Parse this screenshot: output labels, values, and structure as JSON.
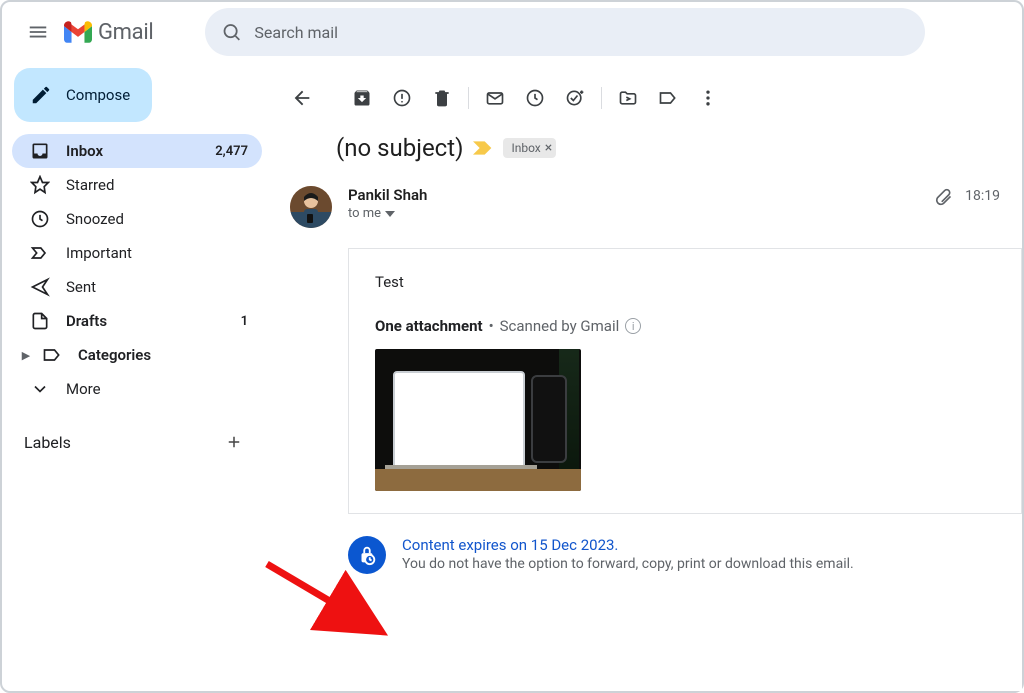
{
  "app": {
    "brand": "Gmail"
  },
  "search": {
    "placeholder": "Search mail"
  },
  "compose": {
    "label": "Compose"
  },
  "sidebar": {
    "items": [
      {
        "label": "Inbox",
        "count": "2,477"
      },
      {
        "label": "Starred",
        "count": ""
      },
      {
        "label": "Snoozed",
        "count": ""
      },
      {
        "label": "Important",
        "count": ""
      },
      {
        "label": "Sent",
        "count": ""
      },
      {
        "label": "Drafts",
        "count": "1"
      },
      {
        "label": "Categories",
        "count": ""
      },
      {
        "label": "More",
        "count": ""
      }
    ],
    "labels_heading": "Labels"
  },
  "message": {
    "subject": "(no subject)",
    "folder_chip": "Inbox",
    "sender_name": "Pankil Shah",
    "recipient_line": "to me",
    "time": "18:19",
    "body_text": "Test",
    "attachment_count_label": "One attachment",
    "scanned_label": "Scanned by Gmail"
  },
  "confidential": {
    "line1": "Content expires on 15 Dec 2023.",
    "line2": "You do not have the option to forward, copy, print or download this email."
  }
}
